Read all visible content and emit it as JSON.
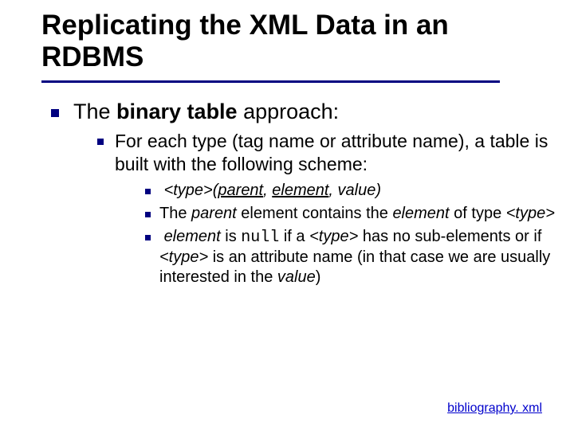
{
  "title": "Replicating the XML Data in an RDBMS",
  "l1": {
    "prefix": "The ",
    "bold": "binary table",
    "suffix": " approach:"
  },
  "l2": "For each type (tag name or attribute name), a table is built with the following scheme:",
  "l3a": {
    "type": "<type>",
    "open": "(",
    "parent": "parent",
    "sep1": ", ",
    "element": "element",
    "sep2": ", ",
    "value": "value",
    "close": ")"
  },
  "l3b": {
    "t1": "The ",
    "parent": "parent",
    "t2": " element contains the ",
    "element": "element",
    "t3": " of type ",
    "type": "<type>"
  },
  "l3c": {
    "element": "element",
    "t1": " is ",
    "null": "null",
    "t2": " if a ",
    "type1": "<type>",
    "t3": " has no sub-elements or if ",
    "type2": "<type>",
    "t4": " is an attribute name (in that case we are usually interested in the ",
    "value": "value",
    "t5": ")"
  },
  "link": "bibliography. xml"
}
